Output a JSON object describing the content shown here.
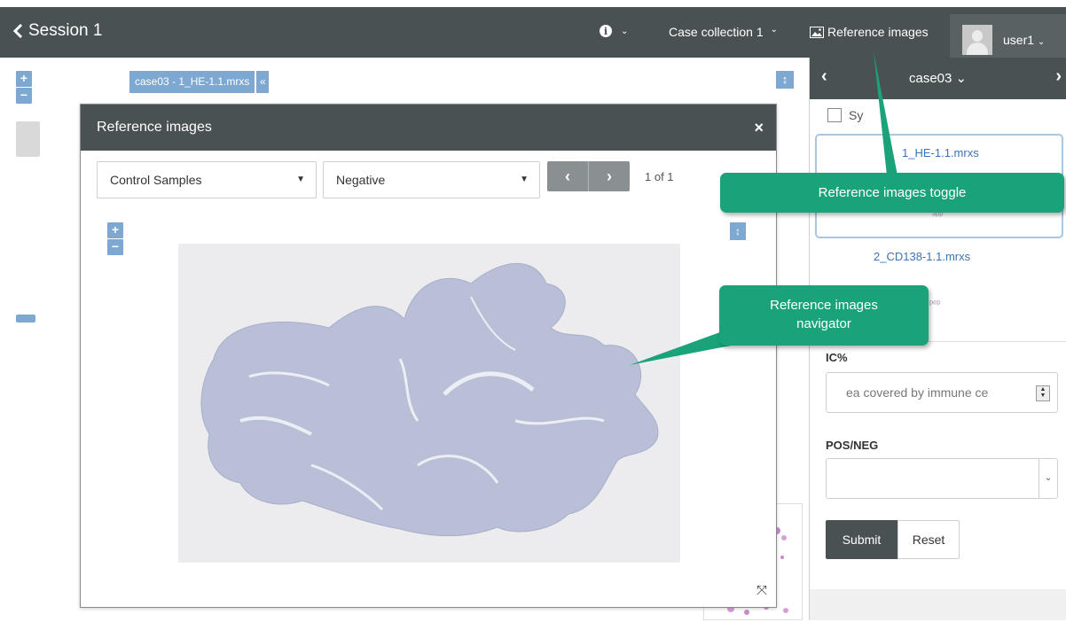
{
  "topbar": {
    "back_label": "Session 1",
    "info_caret": "⌄",
    "case_collection": "Case collection 1",
    "case_collection_caret": "⌄",
    "reference_images": "Reference images",
    "user_name": "user1",
    "user_caret": "⌄"
  },
  "viewer": {
    "zoom_in": "+",
    "zoom_out": "−",
    "slide_tag": "case03 - 1_HE-1.1.mrxs",
    "slide_tag_close": "«",
    "vertical_toggle": "↕"
  },
  "modal": {
    "title": "Reference images",
    "close": "×",
    "category_select": "Control Samples",
    "type_select": "Negative",
    "prev": "‹",
    "next": "›",
    "pager": "1 of 1",
    "zoom_in": "+",
    "zoom_out": "−",
    "vertical_toggle": "↕",
    "expand": "⤧"
  },
  "right_panel": {
    "prev": "‹",
    "next": "›",
    "case_title": "case03",
    "case_caret": "⌄",
    "sync_label": "Sy",
    "thumb1_name": "1_HE-1.1.mrxs",
    "thumb1_wisp": "ᵃᵖᵖ",
    "thumb2_name": "2_CD138-1.1.mrxs",
    "thumb2_wisp": "ᵖᵉᵖ",
    "ic_label": "IC%",
    "ic_placeholder": "ea covered by immune ce",
    "posneg_label": "POS/NEG",
    "submit": "Submit",
    "reset": "Reset"
  },
  "callouts": {
    "toggle_text": "Reference images toggle",
    "navigator_line1": "Reference images",
    "navigator_line2": "navigator"
  },
  "colors": {
    "dark_bar": "#4a5153",
    "accent_blue": "#7da8d1",
    "callout_green": "#1aa37a",
    "link_blue": "#3b73ba"
  },
  "icons": {
    "back": "chevron-left-icon",
    "info": "info-icon",
    "reference_images": "image-icon",
    "avatar": "user-avatar-icon",
    "expand": "expand-icon"
  }
}
